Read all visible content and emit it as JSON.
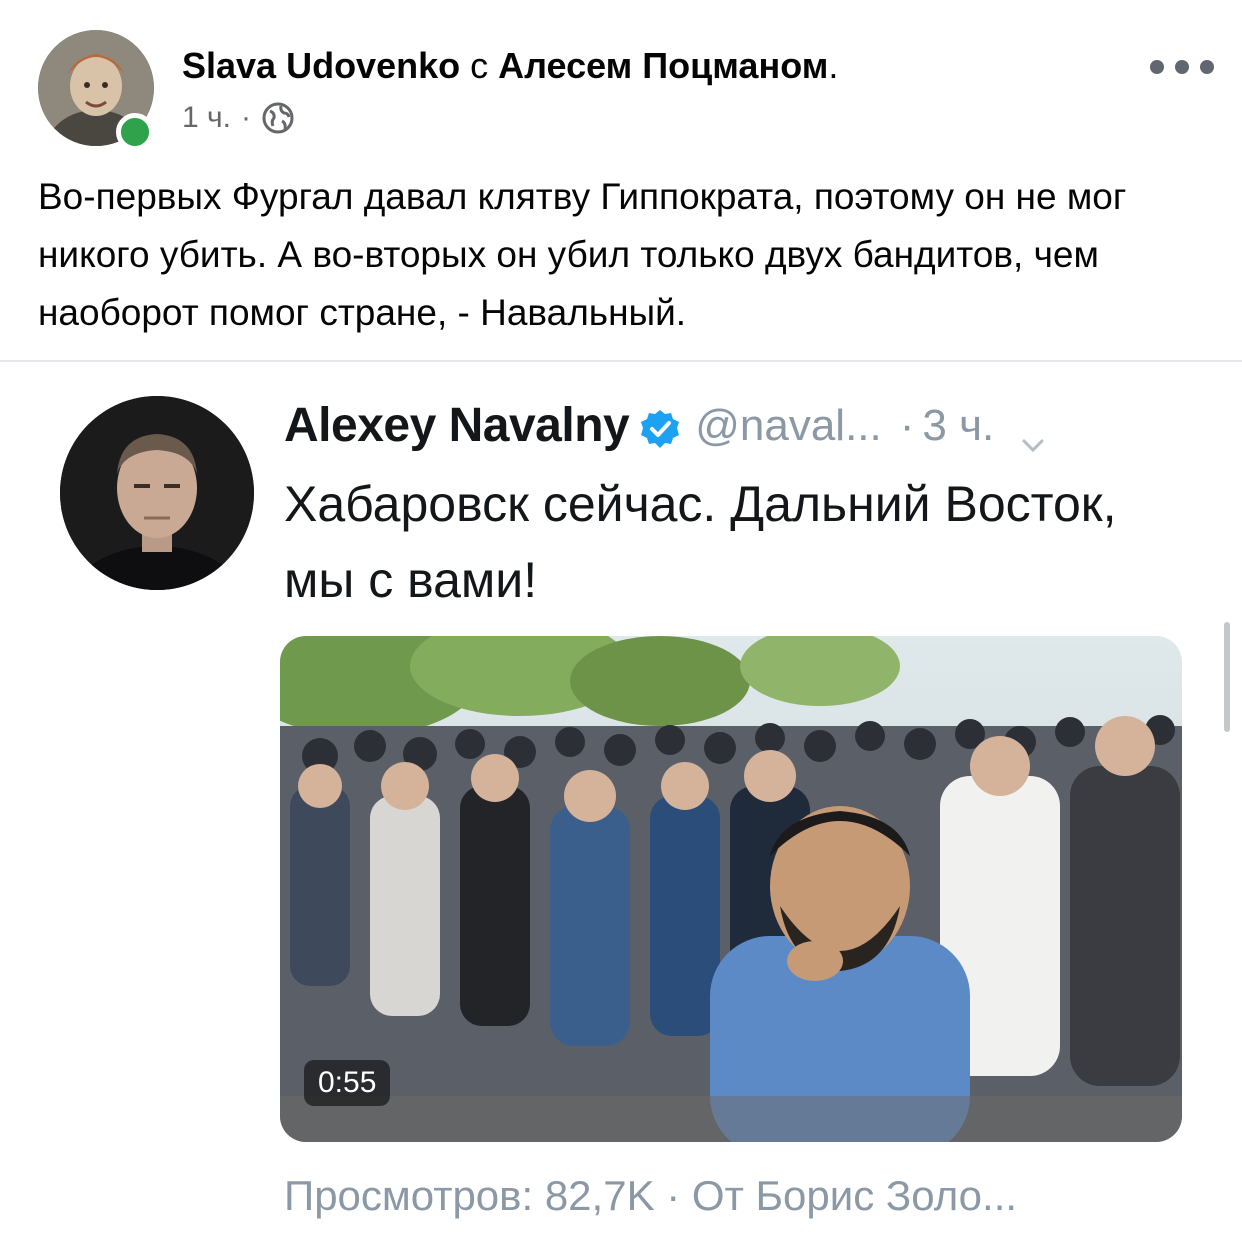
{
  "post": {
    "author": "Slava Udovenko",
    "with_word": "с",
    "tagged": "Алесем Поцманом",
    "period": ".",
    "time": "1 ч.",
    "dot": "·",
    "audience_icon": "globe-icon",
    "text": "Во-первых Фургал давал клятву Гиппократа, поэтому он не мог никого убить. А во-вторых он убил только двух бандитов, чем наоборот помог стране, - Навальный.",
    "online_color": "#31a24c"
  },
  "tweet": {
    "name": "Alexey Navalny",
    "verified_icon": "verified-badge-icon",
    "handle": "@naval...",
    "sep": "·",
    "time": "3 ч.",
    "text": "Хабаровск сейчас. Дальний Восток, мы с вами!",
    "video_duration": "0:55",
    "footer": "Просмотров: 82,7K · От Борис Золо...",
    "verified_color": "#1da1f2"
  }
}
